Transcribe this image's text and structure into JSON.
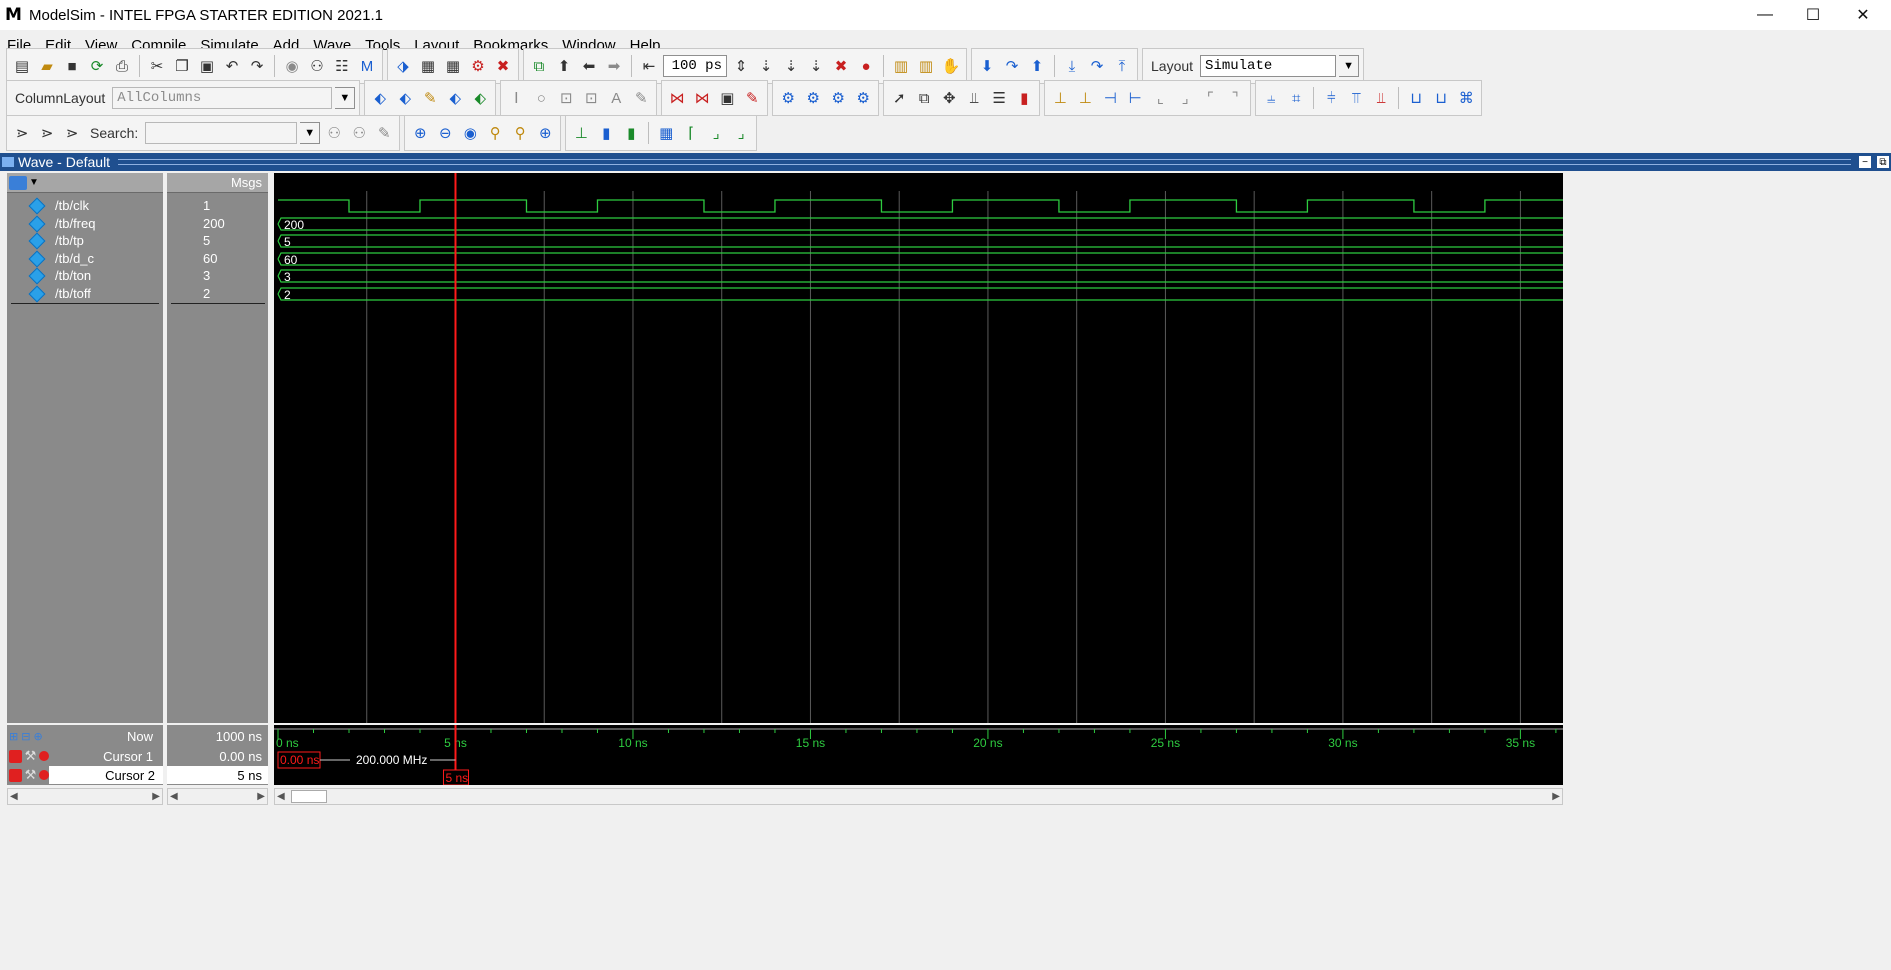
{
  "window": {
    "title": "ModelSim - INTEL FPGA STARTER EDITION 2021.1",
    "logo_letter": "M",
    "controls": {
      "minimize": "—",
      "maximize": "☐",
      "close": "✕"
    }
  },
  "menu": [
    "File",
    "Edit",
    "View",
    "Compile",
    "Simulate",
    "Add",
    "Wave",
    "Tools",
    "Layout",
    "Bookmarks",
    "Window",
    "Help"
  ],
  "toolbar": {
    "run_length": "100 ps",
    "layout_label": "Layout",
    "layout_value": "Simulate",
    "column_layout_label": "ColumnLayout",
    "column_layout_value": "AllColumns",
    "search_label": "Search:",
    "search_value": ""
  },
  "wave_window": {
    "title": "Wave - Default",
    "msgs_header": "Msgs"
  },
  "signals": [
    {
      "name": "/tb/clk",
      "value": "1",
      "wave_label": ""
    },
    {
      "name": "/tb/freq",
      "value": "200",
      "wave_label": "200"
    },
    {
      "name": "/tb/tp",
      "value": "5",
      "wave_label": "5"
    },
    {
      "name": "/tb/d_c",
      "value": "60",
      "wave_label": "60"
    },
    {
      "name": "/tb/ton",
      "value": "3",
      "wave_label": "3"
    },
    {
      "name": "/tb/toff",
      "value": "2",
      "wave_label": "2"
    }
  ],
  "clock": {
    "period_ns": 5,
    "high_ns": 3,
    "low_ns": 2,
    "initial_high_until_ns": 2
  },
  "timeline": {
    "start_ns": 0,
    "end_ns": 36.2,
    "ticks": [
      "0 ns",
      "5 ns",
      "10 ns",
      "15 ns",
      "20 ns",
      "25 ns",
      "30 ns",
      "35 ns"
    ]
  },
  "cursors": {
    "now_label": "Now",
    "now_value": "1000 ns",
    "cursor1_label": "Cursor 1",
    "cursor1_value": "0.00 ns",
    "cursor1_tag": "0.00 ns",
    "cursor2_label": "Cursor 2",
    "cursor2_value": "5 ns",
    "cursor2_tag": "5 ns",
    "cursor2_time_ns": 5,
    "delta_freq": "200.000 MHz"
  },
  "colors": {
    "wave": "#2ecc40",
    "cursor": "#ff1a1a",
    "grid": "#5a5a5a",
    "pane_bg": "#8a8a8a",
    "header_blue": "#1f4f8f"
  }
}
